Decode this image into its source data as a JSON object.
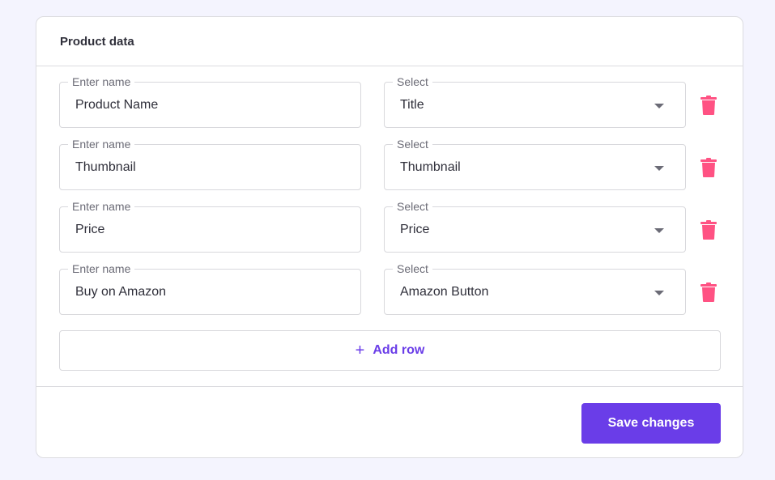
{
  "card": {
    "title": "Product data"
  },
  "rows": [
    {
      "name_label": "Enter name",
      "name_value": "Product Name",
      "select_label": "Select",
      "select_value": "Title"
    },
    {
      "name_label": "Enter name",
      "name_value": "Thumbnail",
      "select_label": "Select",
      "select_value": "Thumbnail"
    },
    {
      "name_label": "Enter name",
      "name_value": "Price",
      "select_label": "Select",
      "select_value": "Price"
    },
    {
      "name_label": "Enter name",
      "name_value": "Buy on Amazon",
      "select_label": "Select",
      "select_value": "Amazon Button"
    }
  ],
  "icons": {
    "delete": "trash-icon",
    "add": "plus-icon",
    "dropdown": "caret-down-icon"
  },
  "add_row": {
    "icon": "+",
    "label": "Add row"
  },
  "save": {
    "label": "Save changes"
  },
  "colors": {
    "accent": "#6a3de8",
    "delete": "#ff5283",
    "background": "#f4f4fe"
  }
}
